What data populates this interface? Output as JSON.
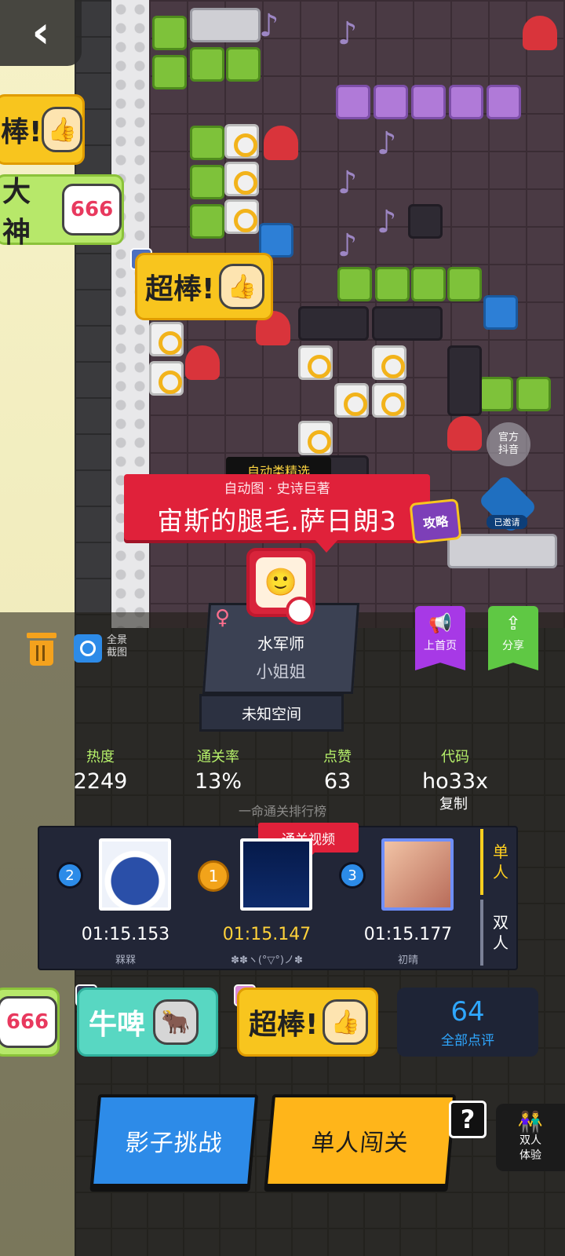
{
  "nav": {
    "back_icon": "‹"
  },
  "stickers": {
    "top_left_super": "棒!",
    "top_left_god": "大神",
    "center_super": "超棒!",
    "pot_666": "666",
    "bottom_666": "666",
    "bottom_niupi": "牛啤",
    "bottom_super": "超棒!"
  },
  "level": {
    "category_tag": "自动类精选",
    "subtitle": "自动图 · 史诗巨著",
    "title": "宙斯的腿毛.萨日朗3",
    "strategy_label": "攻略",
    "official_label_1": "官方",
    "official_label_2": "抖音",
    "followed_label": "已邀请"
  },
  "author": {
    "gender_icon": "♀",
    "name": "水军师",
    "title": "小姐姐",
    "space": "未知空间"
  },
  "tools": {
    "screenshot_label": "全景截图",
    "home_label": "上首页",
    "share_label": "分享"
  },
  "stats": {
    "heat_label": "热度",
    "heat_value": "2249",
    "clear_rate_label": "通关率",
    "clear_rate_value": "13%",
    "likes_label": "点赞",
    "likes_value": "63",
    "code_label": "代码",
    "code_value": "ho33x",
    "copy_label": "复制"
  },
  "leaderboard": {
    "title": "一命通关排行榜",
    "video_tag": "通关视频",
    "entries": [
      {
        "rank": "2",
        "time": "01:15.153",
        "name": "槑槑"
      },
      {
        "rank": "1",
        "time": "01:15.147",
        "name": "✽✽ヽ(°▽°)ノ✽"
      },
      {
        "rank": "3",
        "time": "01:15.177",
        "name": "初晴"
      }
    ],
    "modes": [
      {
        "label_1": "单",
        "label_2": "人"
      },
      {
        "label_1": "双",
        "label_2": "人"
      }
    ]
  },
  "reactions": {
    "count": "64",
    "label": "全部点评"
  },
  "actions": {
    "shadow_challenge": "影子挑战",
    "single_play": "单人闯关",
    "help": "?",
    "duo_line_1": "双人",
    "duo_line_2": "体验"
  },
  "colors": {
    "accent_red": "#e0213a",
    "accent_yellow": "#ffb51a",
    "accent_blue": "#2d8be8",
    "stat_green": "#b6f06a"
  }
}
